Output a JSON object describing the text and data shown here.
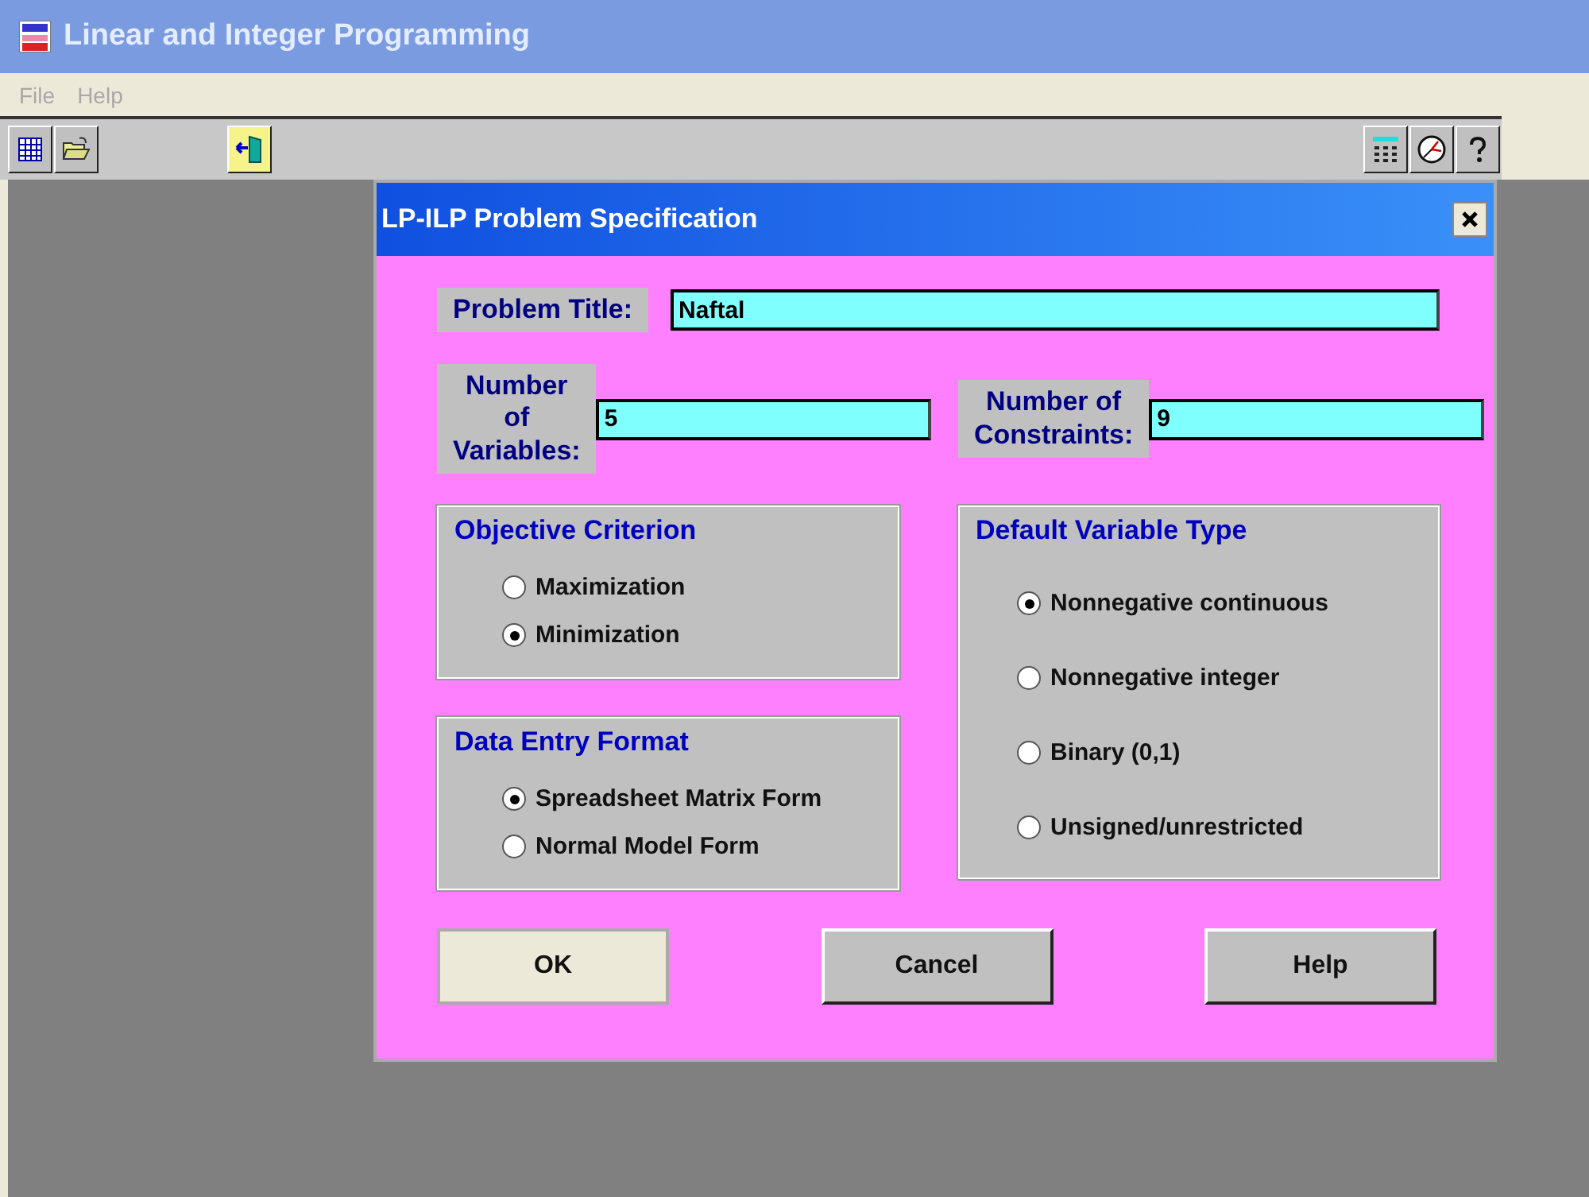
{
  "window": {
    "title": "Linear and Integer Programming"
  },
  "menu": [
    "File",
    "Help"
  ],
  "dialog": {
    "title": "LP-ILP Problem Specification",
    "problem_title": {
      "label": "Problem Title:",
      "value": "Naftal"
    },
    "variables": {
      "label": "Number of Variables:",
      "value": "5"
    },
    "constraints": {
      "label": "Number of Constraints:",
      "value": "9"
    },
    "objective": {
      "title": "Objective Criterion",
      "options": [
        {
          "label": "Maximization",
          "selected": false
        },
        {
          "label": "Minimization",
          "selected": true
        }
      ]
    },
    "data_entry": {
      "title": "Data Entry Format",
      "options": [
        {
          "label": "Spreadsheet Matrix Form",
          "selected": true
        },
        {
          "label": "Normal Model Form",
          "selected": false
        }
      ]
    },
    "variable_type": {
      "title": "Default Variable Type",
      "options": [
        {
          "label": "Nonnegative continuous",
          "selected": true
        },
        {
          "label": "Nonnegative integer",
          "selected": false
        },
        {
          "label": "Binary (0,1)",
          "selected": false
        },
        {
          "label": "Unsigned/unrestricted",
          "selected": false
        }
      ]
    },
    "buttons": [
      {
        "label": "OK",
        "focused": true
      },
      {
        "label": "Cancel",
        "focused": false
      },
      {
        "label": "Help",
        "focused": false
      }
    ]
  }
}
